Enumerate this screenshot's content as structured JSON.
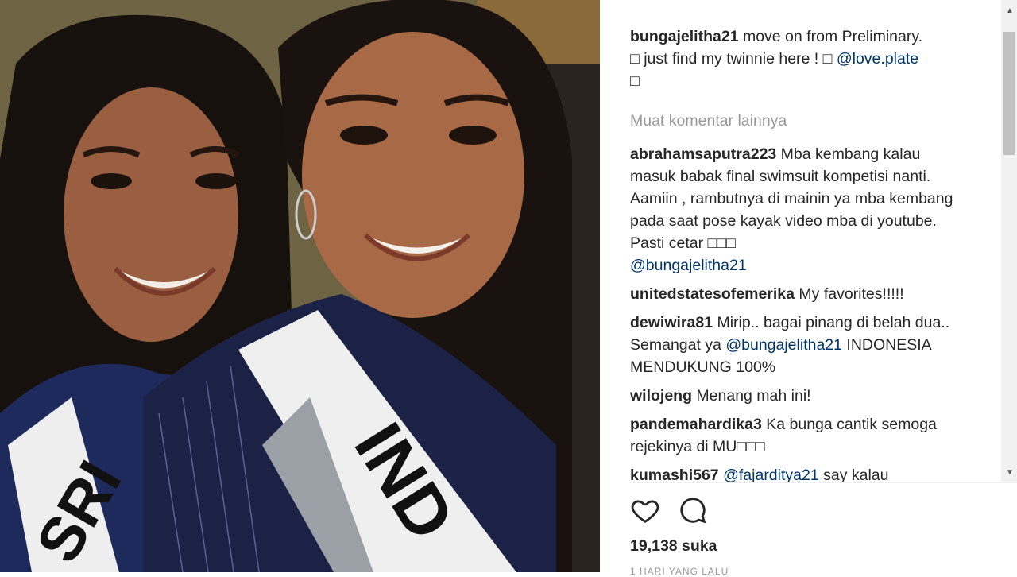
{
  "caption": {
    "user": "bungajelitha21",
    "text": " move on from Preliminary.",
    "line2": "□ just find my twinnie here ! □ ",
    "mention": "@love.plate",
    "line3": "□"
  },
  "load_more": "Muat komentar lainnya",
  "comments": [
    {
      "user": "abrahamsaputra223",
      "text": " Mba kembang kalau masuk babak final swimsuit kompetisi nanti. Aamiin , rambutnya di mainin ya mba kembang pada saat pose kayak video mba di youtube. Pasti cetar □□□",
      "mention": "@bungajelitha21",
      "after": ""
    },
    {
      "user": "unitedstatesofemerika",
      "text": " My favorites!!!!!",
      "mention": "",
      "after": ""
    },
    {
      "user": "dewiwira81",
      "text": " Mirip.. bagai pinang di belah dua.. Semangat ya ",
      "mention": "@bungajelitha21",
      "after": " INDONESIA MENDUKUNG 100%"
    },
    {
      "user": "wilojeng",
      "text": " Menang mah ini!",
      "mention": "",
      "after": ""
    },
    {
      "user": "pandemahardika3",
      "text": " Ka bunga cantik semoga rejekinya di MU□□□",
      "mention": "",
      "after": ""
    },
    {
      "user": "kumashi567",
      "text": " ",
      "mention": "@fajarditya21",
      "after": " say kalau"
    }
  ],
  "likes": "19,138 suka",
  "timestamp": "1 HARI YANG LALU",
  "icons": {
    "like": "heart-icon",
    "comment": "comment-bubble-icon"
  },
  "photo": {
    "left_sash": "SRI",
    "right_sash": "IND"
  }
}
